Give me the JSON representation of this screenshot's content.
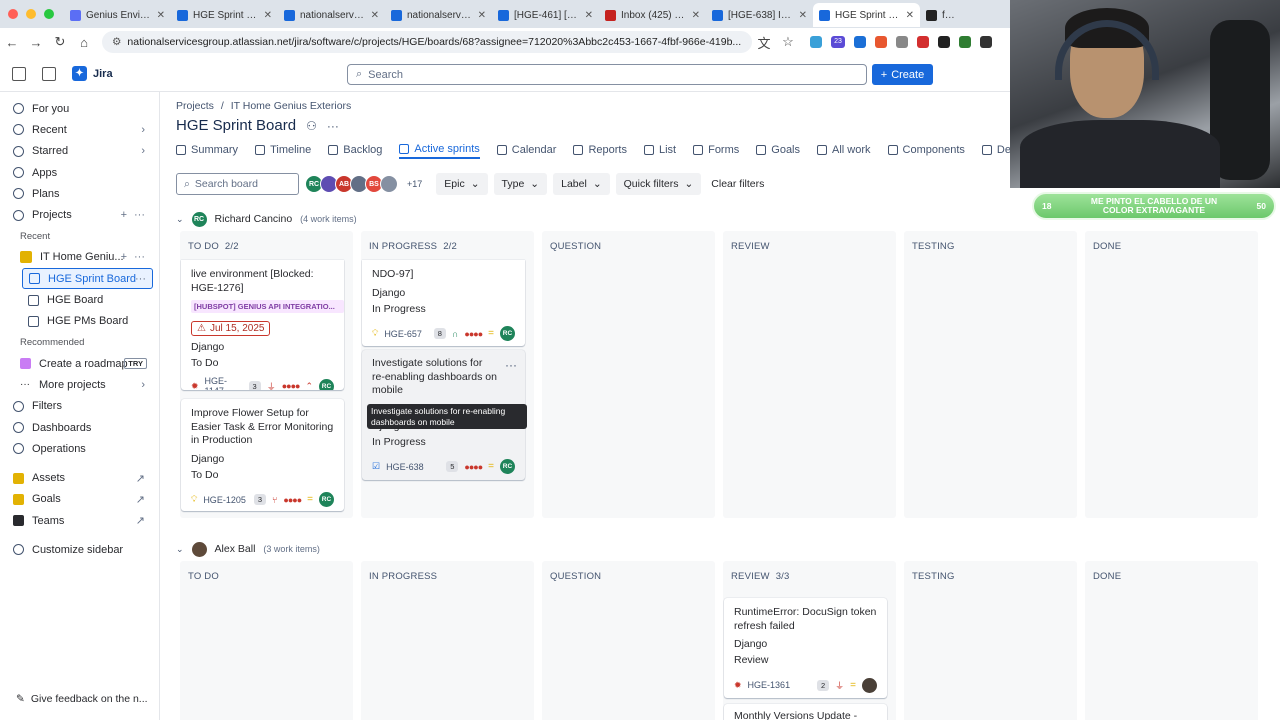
{
  "browser": {
    "tabs": [
      {
        "title": "Genius Environme",
        "color": "#5b6ef5"
      },
      {
        "title": "HGE Sprint 14 - H",
        "color": "#1868db"
      },
      {
        "title": "nationalservicesgr",
        "color": "#1868db"
      },
      {
        "title": "nationalservicesgr",
        "color": "#1868db"
      },
      {
        "title": "[HGE-461] [Home",
        "color": "#1868db"
      },
      {
        "title": "Inbox (425) - rcan",
        "color": "#c5221f"
      },
      {
        "title": "[HGE-638] Invest",
        "color": "#1868db"
      },
      {
        "title": "HGE Sprint 14 - H",
        "color": "#1868db"
      },
      {
        "title": "free",
        "color": "#222"
      }
    ],
    "url": "nationalservicesgroup.atlassian.net/jira/software/c/projects/HGE/boards/68?assignee=712020%3Abbc2c453-1667-4fbf-966e-419b...",
    "ext_badge": "23"
  },
  "topbar": {
    "app": "Jira",
    "search_placeholder": "Search",
    "create": "Create"
  },
  "sidebar": {
    "top": [
      {
        "label": "For you"
      },
      {
        "label": "Recent"
      },
      {
        "label": "Starred"
      },
      {
        "label": "Apps"
      },
      {
        "label": "Plans"
      },
      {
        "label": "Projects"
      }
    ],
    "recent_heading": "Recent",
    "project": "IT Home Geniu...",
    "boards": [
      "HGE Sprint Board",
      "HGE Board",
      "HGE PMs Board"
    ],
    "recommended_heading": "Recommended",
    "roadmap": "Create a roadmap",
    "try": "TRY",
    "more_projects": "More projects",
    "bottom": [
      {
        "label": "Filters"
      },
      {
        "label": "Dashboards"
      },
      {
        "label": "Operations"
      }
    ],
    "links": [
      {
        "label": "Assets"
      },
      {
        "label": "Goals"
      },
      {
        "label": "Teams"
      }
    ],
    "customize": "Customize sidebar",
    "feedback": "Give feedback on the n..."
  },
  "page": {
    "breadcrumb_projects": "Projects",
    "breadcrumb_sep": "/",
    "breadcrumb_project": "IT Home Genius Exteriors",
    "title": "HGE Sprint Board",
    "tabs": [
      "Summary",
      "Timeline",
      "Backlog",
      "Active sprints",
      "Calendar",
      "Reports",
      "List",
      "Forms",
      "Goals",
      "All work",
      "Components",
      "Developmen"
    ],
    "search_board": "Search board",
    "avatars": [
      {
        "i": "RC",
        "c": "#1f845a"
      },
      {
        "i": "",
        "c": "#5e4db2"
      },
      {
        "i": "AB",
        "c": "#c9372c"
      },
      {
        "i": "",
        "c": "#626f86"
      },
      {
        "i": "BS",
        "c": "#e2483d"
      },
      {
        "i": "",
        "c": "#8590a2"
      }
    ],
    "more_avatars": "+17",
    "filters": [
      "Epic",
      "Type",
      "Label",
      "Quick filters"
    ],
    "clear": "Clear filters"
  },
  "board": {
    "columns": [
      "TO DO",
      "IN PROGRESS",
      "QUESTION",
      "REVIEW",
      "TESTING",
      "DONE"
    ],
    "lanes": [
      {
        "name": "Richard Cancino",
        "initials": "RC",
        "count": "(4 work items)",
        "col_counts": [
          "2/2",
          "2/2",
          "",
          "",
          "",
          ""
        ]
      },
      {
        "name": "Alex Ball",
        "initials": "AB",
        "count": "(3 work items)",
        "col_counts": [
          "",
          "",
          "",
          "3/3",
          "",
          ""
        ]
      }
    ],
    "cards": {
      "c1": {
        "title_tail": "live environment [Blocked: HGE-1276]",
        "epic": "[HUBSPOT] GENIUS API INTEGRATIO...",
        "due": "Jul 15, 2025",
        "label": "Django",
        "status": "To Do",
        "key": "HGE-1147",
        "est": "3",
        "av": "RC"
      },
      "c2": {
        "title": "Improve Flower Setup for Easier Task & Error Monitoring in Production",
        "label": "Django",
        "status": "To Do",
        "key": "HGE-1205",
        "est": "3",
        "av": "RC"
      },
      "c3": {
        "title_tail": "NDO-97]",
        "label": "Django",
        "status": "In Progress",
        "key": "HGE-657",
        "est": "8",
        "av": "RC"
      },
      "c4": {
        "title": "Investigate solutions for re-enabling dashboards on mobile",
        "tooltip": "Investigate solutions for re-enabling dashboards on mobile",
        "label": "Django",
        "status": "In Progress",
        "key": "HGE-638",
        "est": "5",
        "av": "RC"
      },
      "c5": {
        "title": "RuntimeError: DocuSign token refresh failed",
        "label": "Django",
        "status": "Review",
        "key": "HGE-1361",
        "est": "2"
      },
      "c6": {
        "title": "Monthly Versions Update -"
      }
    }
  },
  "overlay": {
    "left": "18",
    "text": "ME PINTO EL CABELLO DE UN COLOR EXTRAVAGANTE",
    "right": "50"
  }
}
